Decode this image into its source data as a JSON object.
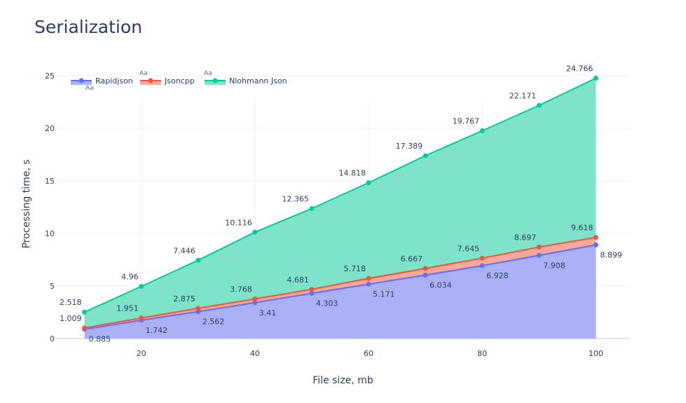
{
  "chart_data": {
    "type": "area",
    "title": "Serialization",
    "xlabel": "File size, mb",
    "ylabel": "Processing time, s",
    "x": [
      10,
      20,
      30,
      40,
      50,
      60,
      70,
      80,
      90,
      100
    ],
    "xlim": [
      5,
      106
    ],
    "ylim": [
      -0.6,
      26.2
    ],
    "x_ticks": [
      20,
      40,
      60,
      80,
      100
    ],
    "y_ticks": [
      0,
      5,
      10,
      15,
      20,
      25
    ],
    "grid": true,
    "stacked": false,
    "legend_position": "top-left",
    "legend_markers": [
      "Aa",
      "Aa",
      "Aa"
    ],
    "series": [
      {
        "name": "Rapidjson",
        "values": [
          0.885,
          1.742,
          2.562,
          3.41,
          4.303,
          5.171,
          6.034,
          6.928,
          7.908,
          8.899
        ],
        "labels": [
          "0.885",
          "1.742",
          "2.562",
          "3.41",
          "4.303",
          "5.171",
          "6.034",
          "6.928",
          "7.908",
          "8.899"
        ],
        "label_position": "below",
        "color": "#636efa",
        "fill": "#aab1f7"
      },
      {
        "name": "Jsoncpp",
        "values": [
          1.009,
          1.951,
          2.875,
          3.768,
          4.681,
          5.718,
          6.667,
          7.645,
          8.697,
          9.618
        ],
        "labels": [
          "1.009",
          "1.951",
          "2.875",
          "3.768",
          "4.681",
          "5.718",
          "6.667",
          "7.645",
          "8.697",
          "9.618"
        ],
        "label_position": "above",
        "color": "#ef553b",
        "fill": "#f4a99c"
      },
      {
        "name": "Nlohmann Json",
        "values": [
          2.518,
          4.96,
          7.446,
          10.116,
          12.365,
          14.818,
          17.389,
          19.767,
          22.171,
          24.766
        ],
        "labels": [
          "2.518",
          "4.96",
          "7.446",
          "10.116",
          "12.365",
          "14.818",
          "17.389",
          "19.767",
          "22.171",
          "24.766"
        ],
        "label_position": "above",
        "color": "#00cc96",
        "fill": "#7ee3c8"
      }
    ]
  }
}
